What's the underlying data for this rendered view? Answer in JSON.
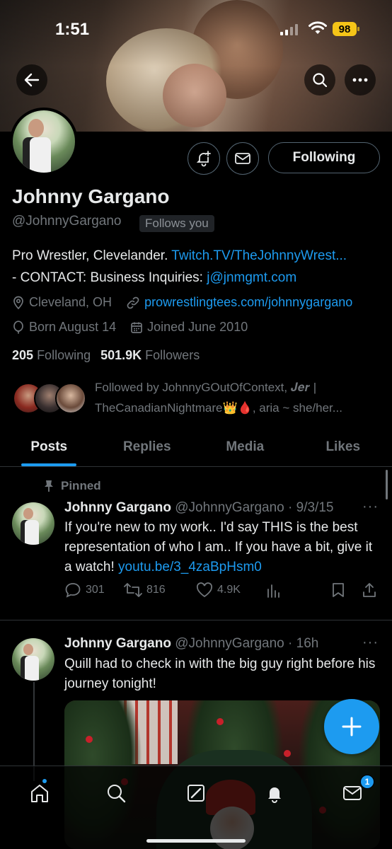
{
  "status_bar": {
    "time": "1:51",
    "battery": "98"
  },
  "profile": {
    "name": "Johnny Gargano",
    "handle": "@JohnnyGargano",
    "follows_you": "Follows you",
    "bio_text": "Pro Wrestler, Clevelander. ",
    "bio_link": "Twitch.TV/TheJohnnyWrest...",
    "bio_text2": "- CONTACT: Business Inquiries: ",
    "bio_email": "j@jnmgmt.com",
    "location": "Cleveland, OH",
    "website": "prowrestlingtees.com/johnnygargano",
    "birthday": "Born August 14",
    "joined": "Joined June 2010",
    "following_count": "205",
    "following_label": "Following",
    "followers_count": "501.9K",
    "followers_label": "Followers",
    "followed_by_line1": "Followed by JohnnyGOutOfContext, 𝑱𝒆𝒓 |",
    "followed_by_line2": "TheCanadianNightmare👑🩸, aria ~ she/her..."
  },
  "actions": {
    "following_button": "Following"
  },
  "tabs": [
    "Posts",
    "Replies",
    "Media",
    "Likes"
  ],
  "posts": [
    {
      "pinned_label": "Pinned",
      "author": "Johnny Gargano",
      "meta": " @JohnnyGargano · 9/3/15",
      "text": "If you're new to my work.. I'd say THIS is the best representation of who I am.. If you have a bit, give it a watch! ",
      "link": "youtu.be/3_4zaBpHsm0",
      "replies": "301",
      "reposts": "816",
      "likes": "4.9K"
    },
    {
      "author": "Johnny Gargano",
      "meta": " @JohnnyGargano · 16h",
      "text": "Quill had to check in with the big guy right before his journey tonight!"
    }
  ],
  "bottom_nav": {
    "messages_badge": "1"
  },
  "colors": {
    "accent": "#1d9bf0",
    "background": "#000000",
    "muted": "#71767b"
  }
}
